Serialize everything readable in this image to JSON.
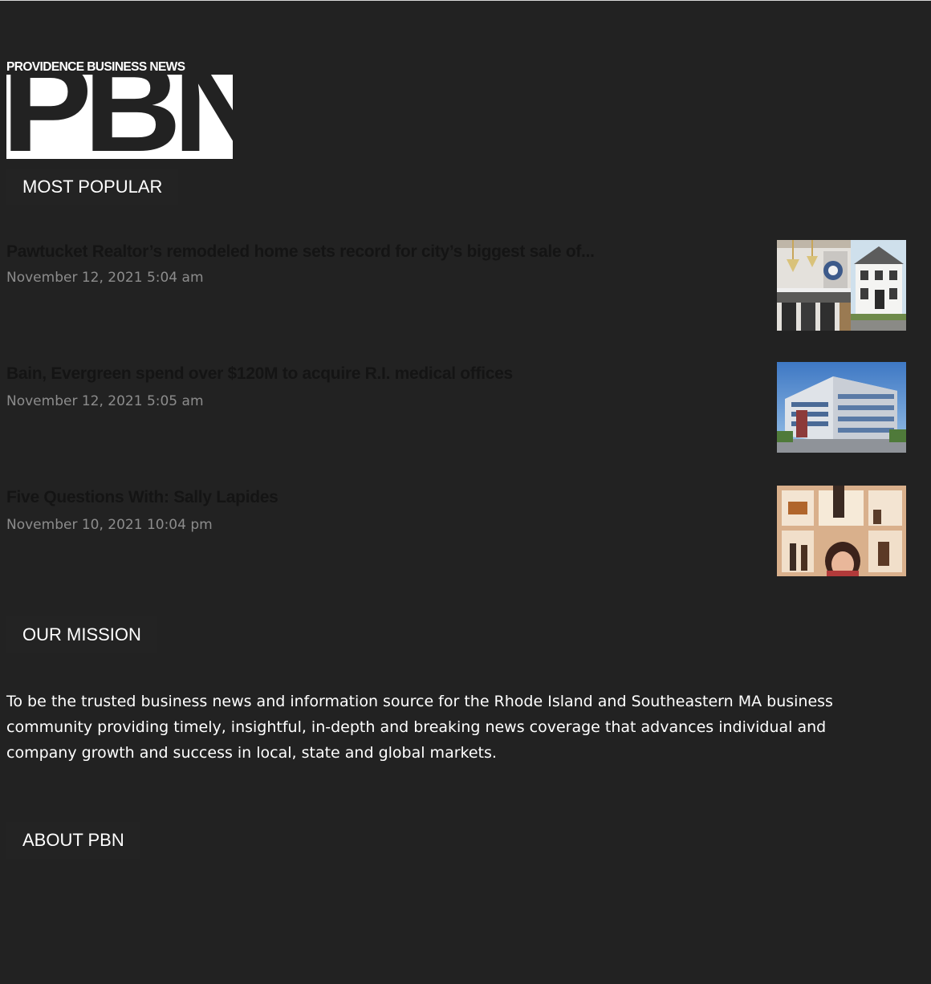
{
  "logo": {
    "tagline": "PROVIDENCE BUSINESS NEWS",
    "mark": "PBN"
  },
  "most_popular": {
    "heading": "MOST POPULAR",
    "articles": [
      {
        "title": "Pawtucket Realtor’s remodeled home sets record for city’s biggest sale of...",
        "date": "November 12, 2021 5:04 am",
        "thumb": "house-interior-photo"
      },
      {
        "title": "Bain, Evergreen spend over $120M to acquire R.I. medical offices",
        "date": "November 12, 2021 5:05 am",
        "thumb": "office-building-photo"
      },
      {
        "title": "Five Questions With: Sally Lapides",
        "date": "November 10, 2021 10:04 pm",
        "thumb": "portrait-photo"
      }
    ]
  },
  "our_mission": {
    "heading": "OUR MISSION",
    "text": "To be the trusted business news and information source for the Rhode Island and Southeastern MA business community providing timely, insightful, in-depth and breaking news coverage that advances individual and company growth and success in local, state and global markets."
  },
  "about": {
    "heading": "ABOUT PBN"
  }
}
